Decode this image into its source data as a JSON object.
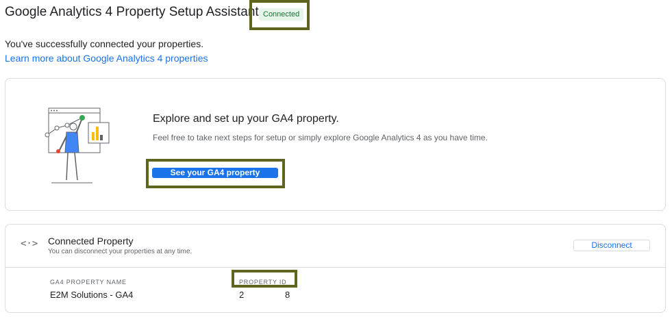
{
  "header": {
    "title": "Google Analytics 4 Property Setup Assistant",
    "status": "Connected"
  },
  "intro": {
    "message": "You've successfully connected your properties.",
    "learn_more_link": "Learn more about Google Analytics 4 properties"
  },
  "explore_card": {
    "illustration": "analytics-illustration",
    "title": "Explore and set up your GA4 property.",
    "description": "Feel free to take next steps for setup or simply explore Google Analytics 4 as you have time.",
    "button_label": "See your GA4 property"
  },
  "connected_property": {
    "icon": "link-icon",
    "title": "Connected Property",
    "subtitle": "You can disconnect your properties at any time.",
    "disconnect_label": "Disconnect",
    "columns": {
      "name_header": "GA4 PROPERTY NAME",
      "id_header": "PROPERTY ID"
    },
    "row": {
      "name": "E2M Solutions - GA4",
      "id_start": "2",
      "id_end": "8"
    }
  },
  "colors": {
    "accent": "#1a73e8",
    "highlight_border": "#5f6421",
    "status_bg": "#e6f4ea",
    "status_text": "#137333"
  }
}
